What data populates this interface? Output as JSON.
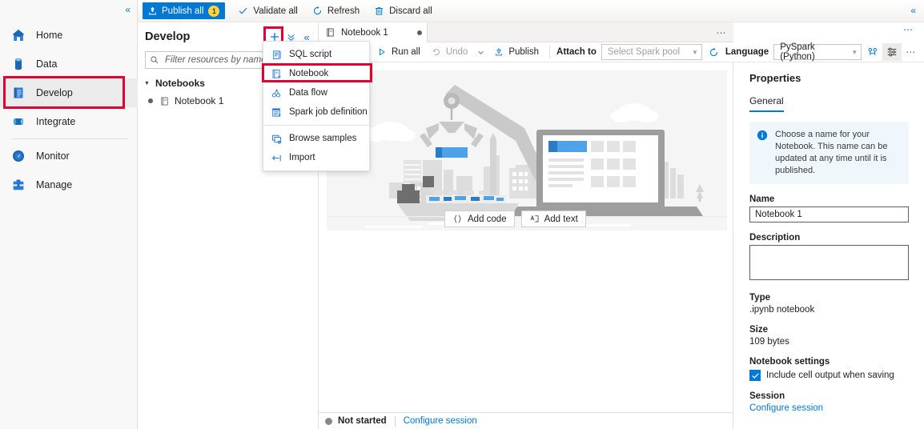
{
  "left_rail": {
    "collapse_icon": "double-chevron-left-icon",
    "items": [
      {
        "label": "Home",
        "icon": "home-icon",
        "active": false
      },
      {
        "label": "Data",
        "icon": "database-icon",
        "active": false
      },
      {
        "label": "Develop",
        "icon": "develop-document-icon",
        "active": true
      },
      {
        "label": "Integrate",
        "icon": "integrate-pipeline-icon",
        "active": false
      },
      {
        "label": "Monitor",
        "icon": "monitor-gauge-icon",
        "active": false
      },
      {
        "label": "Manage",
        "icon": "manage-toolbox-icon",
        "active": false
      }
    ]
  },
  "topbar": {
    "publish_all_label": "Publish all",
    "publish_all_badge": "1",
    "validate_all_label": "Validate all",
    "refresh_label": "Refresh",
    "discard_all_label": "Discard all",
    "collapse_icon": "double-chevron-left-icon"
  },
  "develop_panel": {
    "title": "Develop",
    "add_icon": "plus-icon",
    "actions_icon": "chevron-double-down-icon",
    "collapse_icon": "double-chevron-left-icon",
    "filter_placeholder": "Filter resources by name",
    "filter_value": "",
    "search_icon": "search-icon",
    "tree": [
      {
        "group_label": "Notebooks",
        "expanded": true,
        "items": [
          {
            "label": "Notebook 1",
            "icon": "notebook-icon",
            "unsaved": true
          }
        ]
      }
    ]
  },
  "add_menu": {
    "items": [
      {
        "label": "SQL script",
        "icon": "sql-script-icon"
      },
      {
        "label": "Notebook",
        "icon": "notebook-add-icon",
        "highlighted": true
      },
      {
        "label": "Data flow",
        "icon": "data-flow-icon"
      },
      {
        "label": "Spark job definition",
        "icon": "spark-job-icon"
      },
      {
        "label": "Browse samples",
        "icon": "browse-samples-icon"
      },
      {
        "label": "Import",
        "icon": "import-arrow-icon"
      }
    ]
  },
  "tabstrip": {
    "tab_label": "Notebook 1",
    "tab_icon": "notebook-icon",
    "unsaved_indicator": true,
    "more_icon": "ellipsis-icon"
  },
  "notebook_toolbar": {
    "run_all_label": "Run all",
    "run_all_icon": "play-icon",
    "undo_label": "Undo",
    "undo_icon": "undo-icon",
    "undo_disabled": true,
    "more_chevron_icon": "chevron-down-icon",
    "publish_label": "Publish",
    "publish_icon": "publish-upload-icon",
    "attach_to_label": "Attach to",
    "spark_pool_placeholder": "Select Spark pool",
    "refresh_icon": "refresh-circle-icon",
    "language_label": "Language",
    "language_value": "PySpark (Python)",
    "outline_icon": "outline-icon",
    "settings_icon": "notebook-settings-icon",
    "more_icon": "ellipsis-icon"
  },
  "canvas": {
    "add_code_label": "Add code",
    "add_code_icon": "curly-braces-icon",
    "add_text_label": "Add text",
    "add_text_icon": "text-box-icon",
    "illustration_name": "synapse-empty-notebook-illustration"
  },
  "statusbar": {
    "session_state": "Not started",
    "state_dot_color": "#8a8886",
    "configure_session_label": "Configure session"
  },
  "properties": {
    "title": "Properties",
    "tab_general": "General",
    "info_icon": "info-circle-icon",
    "info_text": "Choose a name for your Notebook. This name can be updated at any time until it is published.",
    "name_label": "Name",
    "name_value": "Notebook 1",
    "description_label": "Description",
    "description_value": "",
    "type_label": "Type",
    "type_value": ".ipynb notebook",
    "size_label": "Size",
    "size_value": "109 bytes",
    "notebook_settings_label": "Notebook settings",
    "include_cell_output_label": "Include cell output when saving",
    "include_cell_output_checked": true,
    "session_label": "Session",
    "configure_session_label": "Configure session"
  },
  "colors": {
    "accent": "#0078d4",
    "highlight_red": "#e00031",
    "badge_yellow": "#ffd633",
    "info_bg": "#eff6fc",
    "rail_bg": "#f8f8f8",
    "illustration_bg": "#f5f5f5"
  }
}
